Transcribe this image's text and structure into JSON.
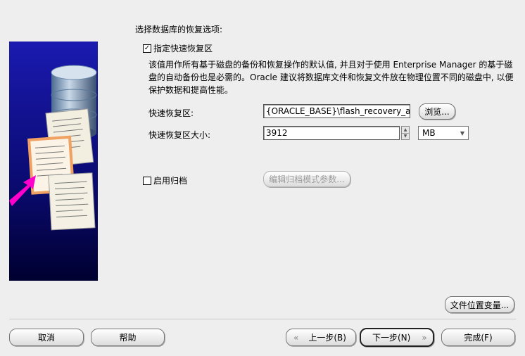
{
  "section_title": "选择数据库的恢复选项:",
  "flash_recovery": {
    "checkbox_label": "指定快速恢复区",
    "checked": true,
    "description": "该值用作所有基于磁盘的备份和恢复操作的默认值, 并且对于使用 Enterprise Manager 的基于磁盘的自动备份也是必需的。Oracle 建议将数据库文件和恢复文件放在物理位置不同的磁盘中, 以便保护数据和提高性能。",
    "area_label": "快速恢复区:",
    "area_value": "{ORACLE_BASE}\\flash_recovery_area",
    "browse_button": "浏览...",
    "size_label": "快速恢复区大小:",
    "size_value": "3912",
    "unit_value": "MB"
  },
  "archive": {
    "checkbox_label": "启用归档",
    "checked": false,
    "edit_button": "编辑归档模式参数..."
  },
  "file_location_button": "文件位置变量...",
  "footer": {
    "cancel": "取消",
    "help": "帮助",
    "back": "上一步(B)",
    "next": "下一步(N)",
    "finish": "完成(F)"
  },
  "icons": {
    "illustration": "database-documents-illustration",
    "back_arrow": "left-chevron-icon",
    "next_arrow": "right-chevron-icon",
    "dropdown": "triangle-down-icon"
  },
  "colors": {
    "background": "#eeeeee",
    "illustration_top": "#1a1aa8",
    "illustration_bottom": "#000040",
    "arrow": "#ff00cc",
    "highlight_doc": "#f0a060"
  }
}
